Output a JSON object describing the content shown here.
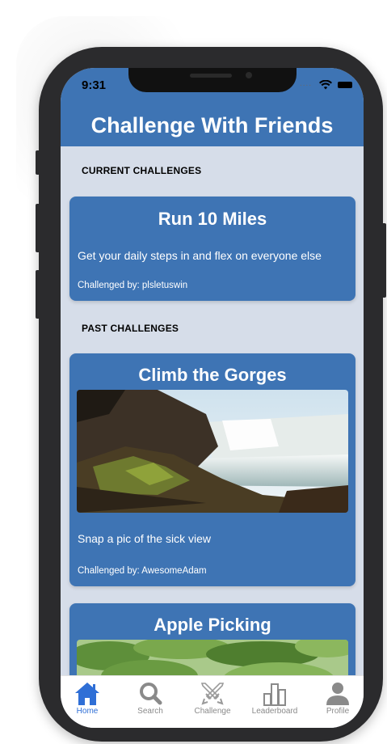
{
  "status": {
    "time": "9:31",
    "dots": "...."
  },
  "header": {
    "title": "Challenge With Friends"
  },
  "sections": {
    "current": "CURRENT CHALLENGES",
    "past": "PAST CHALLENGES"
  },
  "current_challenges": [
    {
      "title": "Run 10 Miles",
      "description": "Get your daily steps in and flex on everyone else",
      "challenged_by": "Challenged by: plsletuswin"
    }
  ],
  "past_challenges": [
    {
      "title": "Climb the Gorges",
      "description": "Snap a pic of the sick view",
      "challenged_by": "Challenged by: AwesomeAdam",
      "image": "waterfall-gorge-photo"
    },
    {
      "title": "Apple Picking",
      "image": "apple-tree-leaves-photo"
    }
  ],
  "tabbar": {
    "items": [
      {
        "label": "Home",
        "icon": "home-icon",
        "active": true
      },
      {
        "label": "Search",
        "icon": "search-icon",
        "active": false
      },
      {
        "label": "Challenge",
        "icon": "crossed-swords-icon",
        "active": false
      },
      {
        "label": "Leaderboard",
        "icon": "bar-chart-icon",
        "active": false
      },
      {
        "label": "Profile",
        "icon": "person-icon",
        "active": false
      }
    ]
  },
  "colors": {
    "header": "#3e74b4",
    "card": "#3e74b4",
    "background": "#d6dde9",
    "active_tab": "#2f6fd6",
    "inactive_tab": "#8a8a8a"
  }
}
